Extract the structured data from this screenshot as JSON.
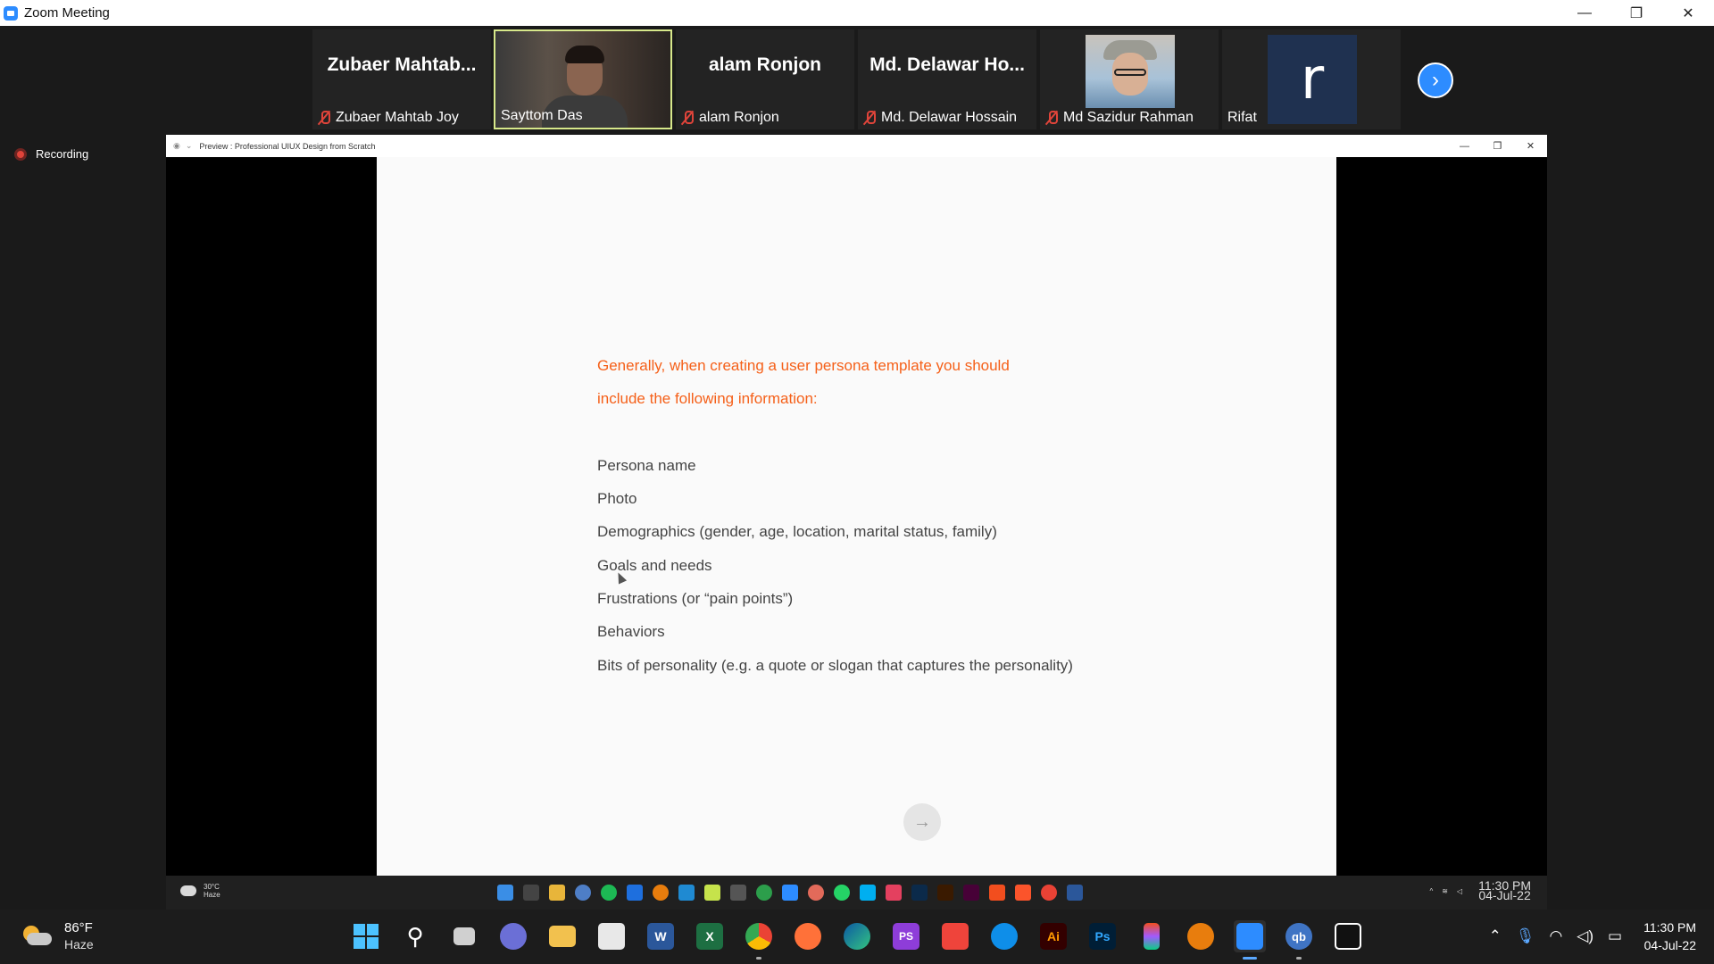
{
  "window": {
    "title": "Zoom Meeting",
    "minimize": "—",
    "restore": "❐",
    "close": "✕"
  },
  "participants": [
    {
      "big_name": "Zubaer  Mahtab...",
      "label": "Zubaer Mahtab Joy",
      "muted": true
    },
    {
      "big_name": "",
      "label": "Sayttom Das",
      "muted": false,
      "video": true,
      "active": true
    },
    {
      "big_name": "alam Ronjon",
      "label": "alam Ronjon",
      "muted": true
    },
    {
      "big_name": "Md.  Delawar  Ho...",
      "label": "Md. Delawar Hossain",
      "muted": true
    },
    {
      "big_name": "",
      "label": "Md Sazidur Rahman",
      "muted": true,
      "photo": true
    },
    {
      "big_name": "",
      "label": "Rifat",
      "muted": false,
      "avatar_letter": "r"
    }
  ],
  "next_page_icon": "chevron-right-icon",
  "recording": {
    "label": "Recording"
  },
  "shared_window": {
    "title": "Preview : Professional UIUX Design from Scratch",
    "btn_min": "—",
    "btn_restore": "❐",
    "btn_close": "✕"
  },
  "slide": {
    "heading_line1": "Generally, when creating a user persona template you should",
    "heading_line2": " include the following information:",
    "items": [
      "Persona name",
      "Photo",
      "Demographics (gender, age, location, marital status, family)",
      "Goals and needs",
      "Frustrations (or “pain points”)",
      "Behaviors",
      "Bits of personality (e.g. a quote or slogan that captures the personality)"
    ],
    "next_arrow": "→",
    "accent_color": "#f56019"
  },
  "inner_taskbar": {
    "weather_temp": "30°C",
    "weather_cond": "Haze",
    "time": "11:30 PM",
    "date": "04-Jul-22"
  },
  "taskbar": {
    "weather_temp": "86°F",
    "weather_cond": "Haze",
    "time": "11:30 PM",
    "date": "04-Jul-22",
    "apps": [
      {
        "name": "start-icon",
        "glyph": ""
      },
      {
        "name": "search-icon",
        "glyph": "⚲"
      },
      {
        "name": "task-view-icon",
        "glyph": ""
      },
      {
        "name": "teams-chat-icon",
        "glyph": ""
      },
      {
        "name": "file-explorer-icon",
        "glyph": ""
      },
      {
        "name": "snipping-tool-icon",
        "glyph": ""
      },
      {
        "name": "word-icon",
        "glyph": "W"
      },
      {
        "name": "excel-icon",
        "glyph": "X"
      },
      {
        "name": "chrome-icon",
        "glyph": ""
      },
      {
        "name": "firefox-icon",
        "glyph": ""
      },
      {
        "name": "edge-icon",
        "glyph": ""
      },
      {
        "name": "phpstorm-icon",
        "glyph": "PS"
      },
      {
        "name": "anydesk-icon",
        "glyph": ""
      },
      {
        "name": "teamviewer-icon",
        "glyph": ""
      },
      {
        "name": "illustrator-icon",
        "glyph": "Ai"
      },
      {
        "name": "photoshop-icon",
        "glyph": "Ps"
      },
      {
        "name": "figma-icon",
        "glyph": ""
      },
      {
        "name": "blender-icon",
        "glyph": ""
      },
      {
        "name": "zoom-icon",
        "glyph": ""
      },
      {
        "name": "qbittorrent-icon",
        "glyph": "qb"
      },
      {
        "name": "capcut-icon",
        "glyph": ""
      }
    ]
  }
}
